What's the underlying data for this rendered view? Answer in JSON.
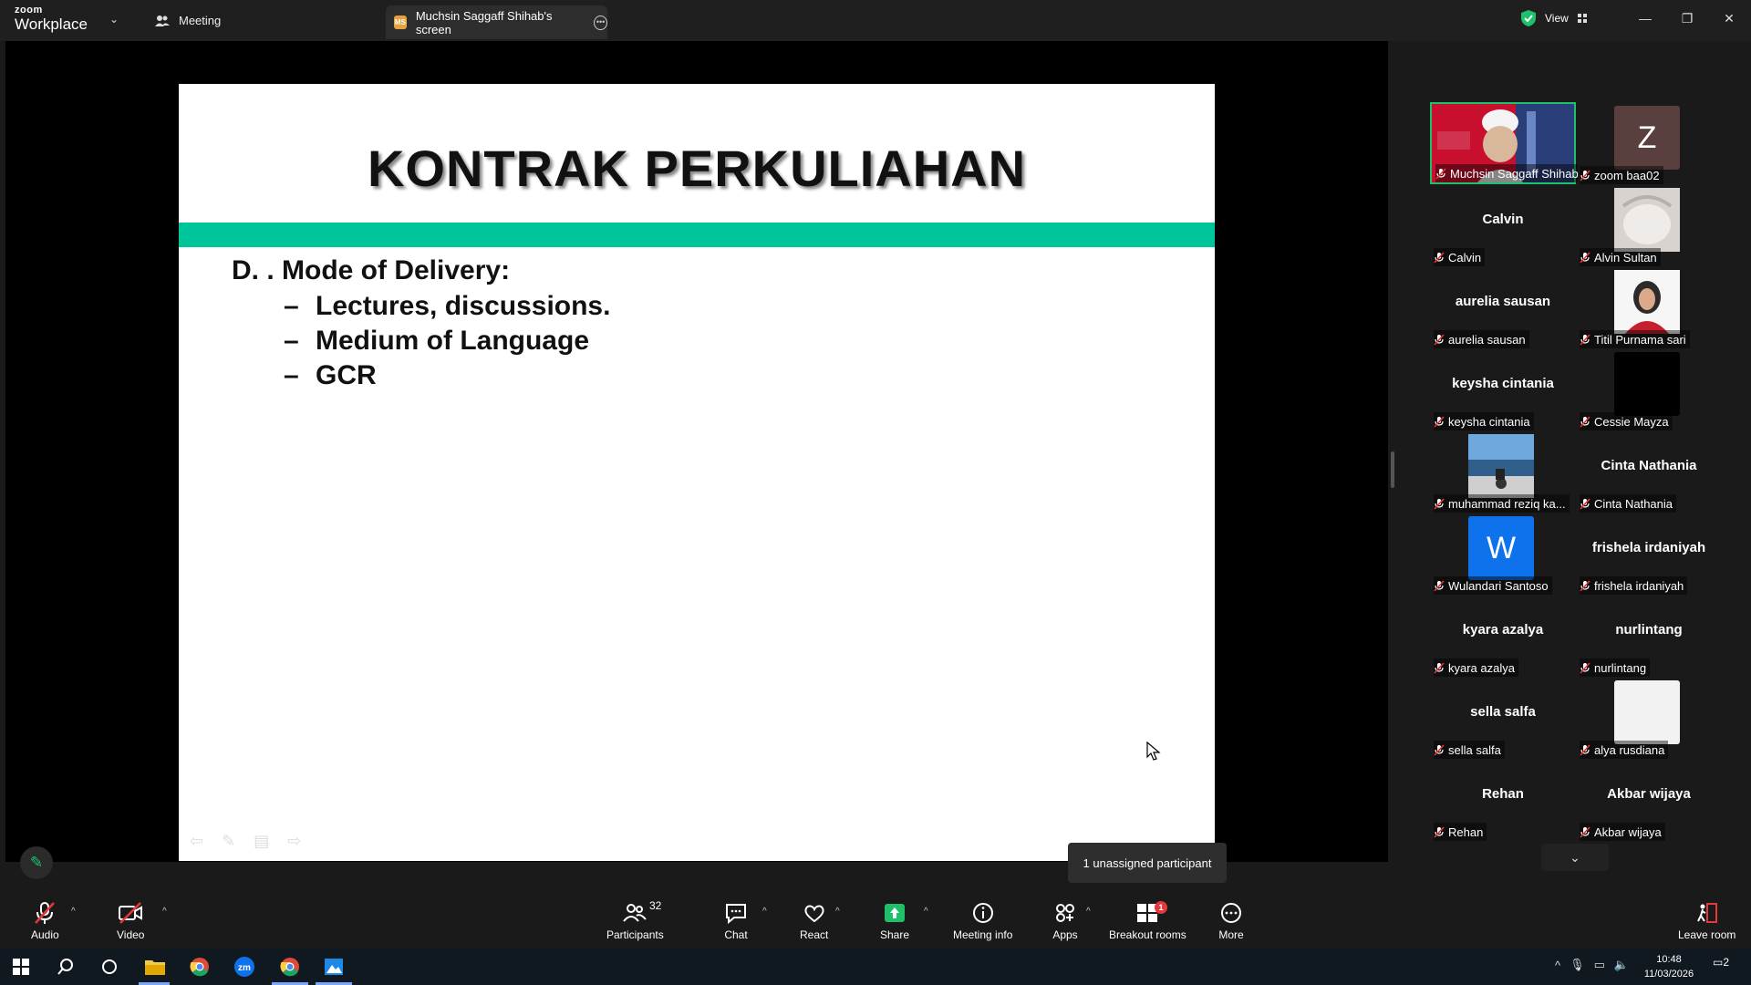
{
  "app": {
    "brand_top": "zoom",
    "brand_bottom": "Workplace",
    "tab_meeting": "Meeting",
    "tab_share_badge": "MS",
    "tab_share": "Muchsin Saggaff Shihab's screen",
    "view_label": "View"
  },
  "slide": {
    "title": "KONTRAK PERKULIAHAN",
    "heading": "D. . Mode of Delivery:",
    "dash": "–",
    "items": [
      "Lectures, discussions.",
      "Medium of Language",
      "GCR"
    ],
    "band_color": "#00c49a"
  },
  "tooltip": "1 unassigned participant",
  "participants": [
    {
      "name": "Muchsin Saggaff Shihab",
      "big": "",
      "kind": "video-red"
    },
    {
      "name": "zoom baa02",
      "big": "",
      "kind": "letter",
      "letter": "Z",
      "color": "#5a3f3f"
    },
    {
      "name": "Calvin",
      "big": "Calvin",
      "kind": "name"
    },
    {
      "name": "Alvin Sultan",
      "big": "",
      "kind": "photo-light"
    },
    {
      "name": "aurelia sausan",
      "big": "aurelia sausan",
      "kind": "name"
    },
    {
      "name": "Titil Purnama sari",
      "big": "",
      "kind": "photo-hijab"
    },
    {
      "name": "keysha cintania",
      "big": "keysha cintania",
      "kind": "name"
    },
    {
      "name": "Cessie Mayza",
      "big": "",
      "kind": "black"
    },
    {
      "name": "muhammad reziq ka...",
      "big": "",
      "kind": "photo-beach"
    },
    {
      "name": "Cinta Nathania",
      "big": "Cinta Nathania",
      "kind": "name"
    },
    {
      "name": "Wulandari Santoso",
      "big": "",
      "kind": "letter",
      "letter": "W",
      "color": "#0e72ed"
    },
    {
      "name": "frishela irdaniyah",
      "big": "frishela irdaniyah",
      "kind": "name"
    },
    {
      "name": "kyara azalya",
      "big": "kyara azalya",
      "kind": "name"
    },
    {
      "name": "nurlintang",
      "big": "nurlintang",
      "kind": "name"
    },
    {
      "name": "sella salfa",
      "big": "sella salfa",
      "kind": "name"
    },
    {
      "name": "alya rusdiana",
      "big": "",
      "kind": "white"
    },
    {
      "name": "Rehan",
      "big": "Rehan",
      "kind": "name"
    },
    {
      "name": "Akbar wijaya",
      "big": "Akbar wijaya",
      "kind": "name"
    }
  ],
  "toolbar": {
    "audio": "Audio",
    "video": "Video",
    "participants": "Participants",
    "participants_count": "32",
    "chat": "Chat",
    "react": "React",
    "share": "Share",
    "meeting_info": "Meeting info",
    "apps": "Apps",
    "breakout": "Breakout rooms",
    "breakout_badge": "1",
    "more": "More",
    "leave": "Leave room"
  },
  "taskbar": {
    "time": "10:48",
    "date": "11/03/2026",
    "notifications": "2"
  },
  "colors": {
    "active_speaker": "#1ec06b",
    "share_green": "#1ec06b",
    "muted_red": "#e5383b"
  }
}
